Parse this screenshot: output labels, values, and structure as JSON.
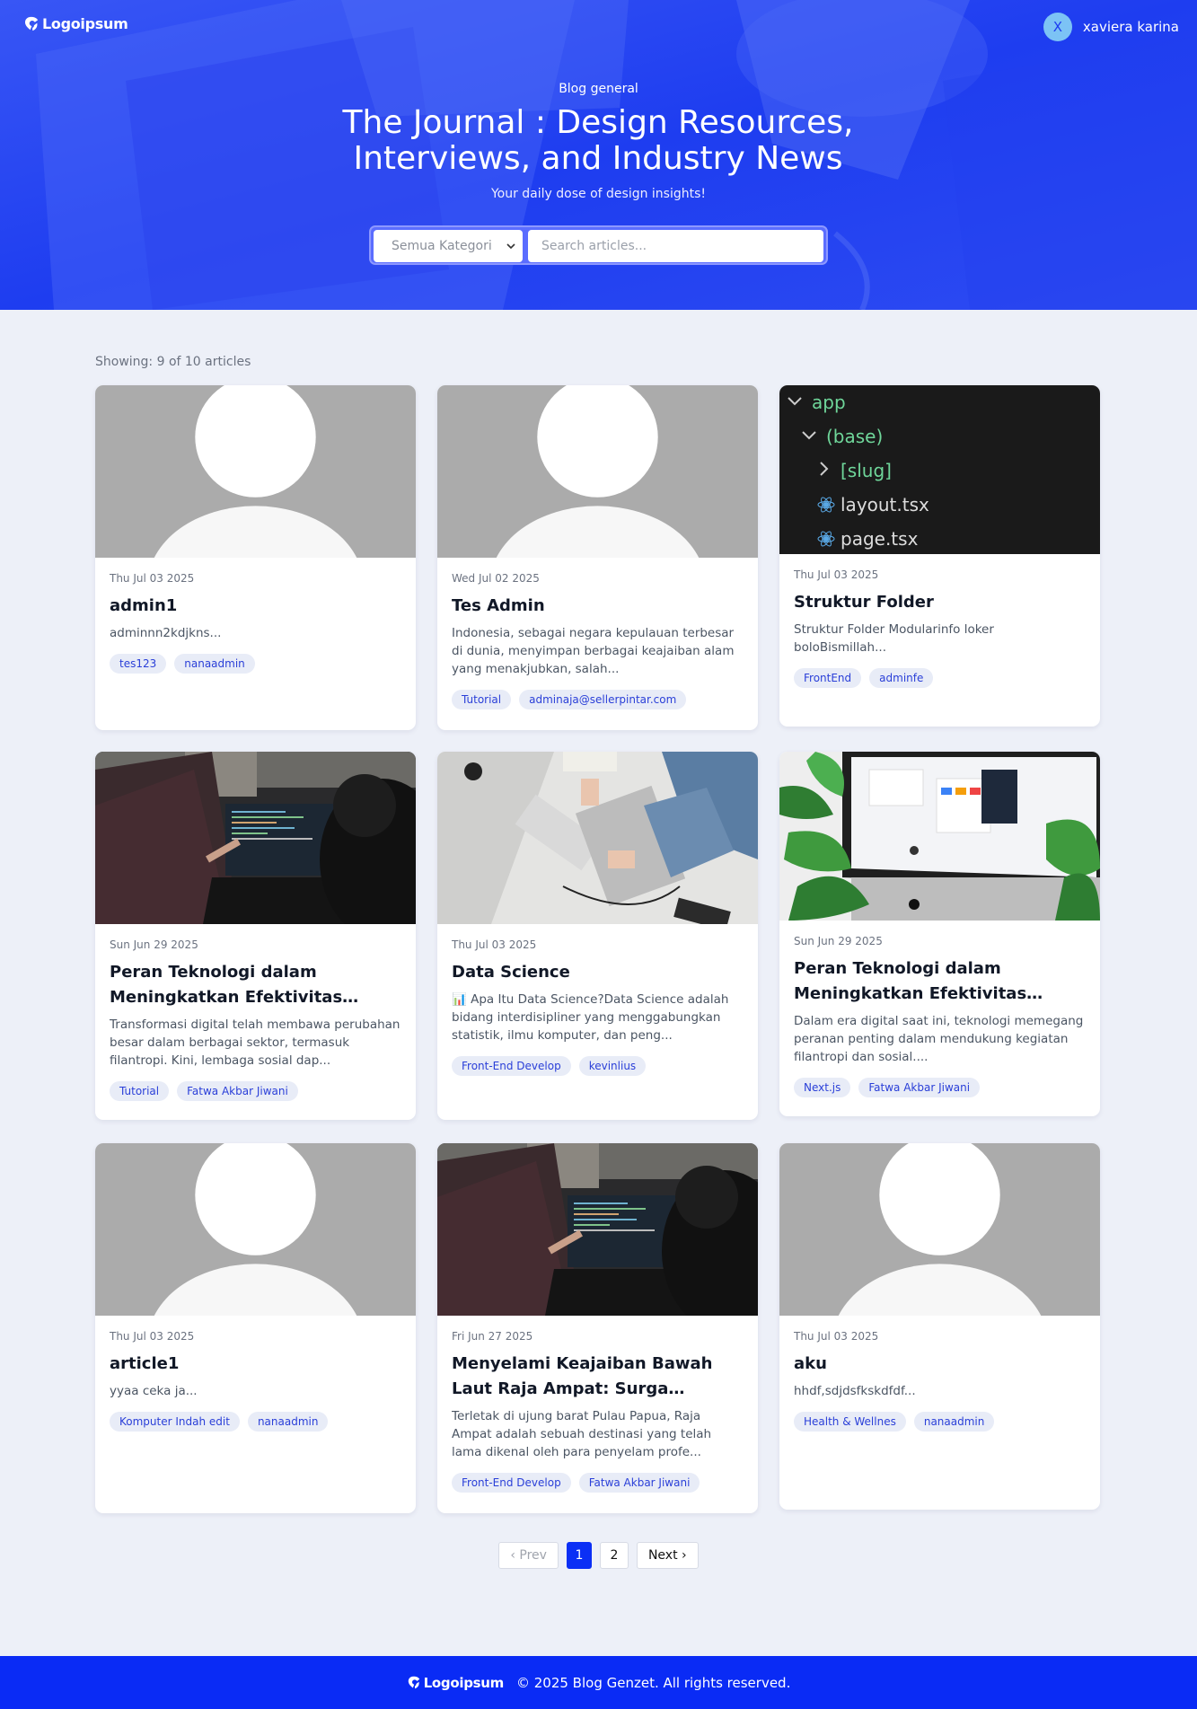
{
  "header": {
    "logo_text": "Logoipsum",
    "user": {
      "initial": "X",
      "name": "xaviera karina"
    }
  },
  "hero": {
    "label": "Blog general",
    "title": "The Journal : Design Resources, Interviews, and Industry News",
    "tagline": "Your daily dose of design insights!",
    "category_select": {
      "selected": "Semua Kategori"
    },
    "search": {
      "placeholder": "Search articles...",
      "value": ""
    }
  },
  "listing": {
    "showing_text": "Showing: 9 of 10 articles",
    "articles": [
      {
        "thumb": "placeholder-avatar",
        "date": "Thu Jul 03 2025",
        "title": "admin1",
        "excerpt": "adminnn2kdjkns...",
        "tags": [
          "tes123",
          "nanaadmin"
        ]
      },
      {
        "thumb": "placeholder-avatar",
        "date": "Wed Jul 02 2025",
        "title": "Tes Admin",
        "excerpt": "Indonesia, sebagai negara kepulauan terbesar di dunia, menyimpan berbagai keajaiban alam yang menakjubkan, salah...",
        "tags": [
          "Tutorial",
          "adminaja@sellerpintar.com"
        ]
      },
      {
        "thumb": "code-folder",
        "date": "Thu Jul 03 2025",
        "title": "Struktur Folder",
        "excerpt": "Struktur Folder Modularinfo loker boloBismillah...",
        "tags": [
          "FrontEnd",
          "adminfe"
        ]
      },
      {
        "thumb": "people-laptop",
        "date": "Sun Jun 29 2025",
        "title": "Peran Teknologi dalam Meningkatkan Efektivitas Donasi...",
        "excerpt": "Transformasi digital telah membawa perubahan besar dalam berbagai sektor, termasuk filantropi. Kini, lembaga sosial dap...",
        "tags": [
          "Tutorial",
          "Fatwa Akbar Jiwani"
        ]
      },
      {
        "thumb": "desk-tablet",
        "date": "Thu Jul 03 2025",
        "title": "Data Science",
        "excerpt": "📊 Apa Itu Data Science?Data Science adalah bidang interdisipliner yang menggabungkan statistik, ilmu komputer, dan peng...",
        "tags": [
          "Front-End Develop",
          "kevinlius"
        ]
      },
      {
        "thumb": "monitor-plant",
        "date": "Sun Jun 29 2025",
        "title": "Peran Teknologi dalam Meningkatkan Efektivitas Donasi...",
        "excerpt": "Dalam era digital saat ini, teknologi memegang peranan penting dalam mendukung kegiatan filantropi dan sosial....",
        "tags": [
          "Next.js",
          "Fatwa Akbar Jiwani"
        ]
      },
      {
        "thumb": "placeholder-avatar",
        "date": "Thu Jul 03 2025",
        "title": "article1",
        "excerpt": "yyaa ceka ja...",
        "tags": [
          "Komputer Indah edit",
          "nanaadmin"
        ]
      },
      {
        "thumb": "people-laptop",
        "date": "Fri Jun 27 2025",
        "title": "Menyelami Keajaiban Bawah Laut Raja Ampat: Surga Tersembunyi ...",
        "excerpt": "Terletak di ujung barat Pulau Papua, Raja Ampat adalah sebuah destinasi yang telah lama dikenal oleh para penyelam profe...",
        "tags": [
          "Front-End Develop",
          "Fatwa Akbar Jiwani"
        ]
      },
      {
        "thumb": "placeholder-avatar",
        "date": "Thu Jul 03 2025",
        "title": "aku",
        "excerpt": "hhdf,sdjdsfkskdfdf...",
        "tags": [
          "Health & Wellnes",
          "nanaadmin"
        ]
      }
    ]
  },
  "pagination": {
    "prev": "‹ Prev",
    "pages": [
      "1",
      "2"
    ],
    "current": "1",
    "next": "Next ›"
  },
  "footer": {
    "logo_text": "Logoipsum",
    "copyright": "© 2025 Blog Genzet. All rights reserved."
  },
  "colors": {
    "brand": "#0a2bf5",
    "hero": "#1d3cf0",
    "tag_bg": "#e8ecf7",
    "tag_text": "#2a3fd8",
    "page_bg": "#edf0f8"
  },
  "code_tree": [
    "app",
    "(base)",
    "[slug]",
    "layout.tsx",
    "page.tsx"
  ]
}
